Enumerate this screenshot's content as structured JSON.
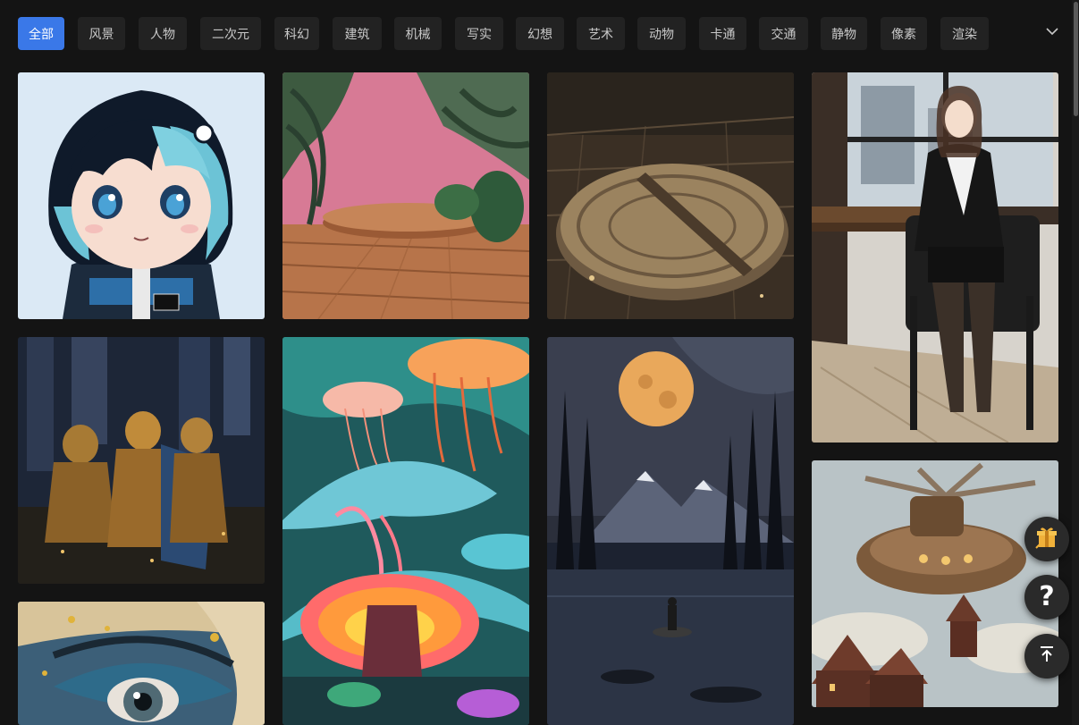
{
  "categories": [
    {
      "label": "全部",
      "active": true
    },
    {
      "label": "风景"
    },
    {
      "label": "人物"
    },
    {
      "label": "二次元"
    },
    {
      "label": "科幻"
    },
    {
      "label": "建筑"
    },
    {
      "label": "机械"
    },
    {
      "label": "写实"
    },
    {
      "label": "幻想"
    },
    {
      "label": "艺术"
    },
    {
      "label": "动物"
    },
    {
      "label": "卡通"
    },
    {
      "label": "交通"
    },
    {
      "label": "静物"
    },
    {
      "label": "像素"
    },
    {
      "label": "渲染"
    }
  ],
  "expand_icon": "chevron-down-icon",
  "gallery": [
    {
      "subject": "anime-girl",
      "icon": "image-thumbnail"
    },
    {
      "subject": "wooden-podium",
      "icon": "image-thumbnail"
    },
    {
      "subject": "stone-sundial",
      "icon": "image-thumbnail"
    },
    {
      "subject": "office-woman",
      "icon": "image-thumbnail"
    },
    {
      "subject": "golden-knights",
      "icon": "image-thumbnail"
    },
    {
      "subject": "mushroom-jellyfish",
      "icon": "image-thumbnail"
    },
    {
      "subject": "moon-lake-forest",
      "icon": "image-thumbnail"
    },
    {
      "subject": "steampunk-airship",
      "icon": "image-thumbnail"
    },
    {
      "subject": "painted-eye",
      "icon": "image-thumbnail"
    }
  ],
  "floating_buttons": [
    {
      "icon": "gift-icon"
    },
    {
      "icon": "help-icon",
      "symbol": "?"
    },
    {
      "icon": "back-to-top-icon"
    }
  ],
  "colors": {
    "background": "#141414",
    "accent": "#3a78e8",
    "chip": "#222222"
  }
}
